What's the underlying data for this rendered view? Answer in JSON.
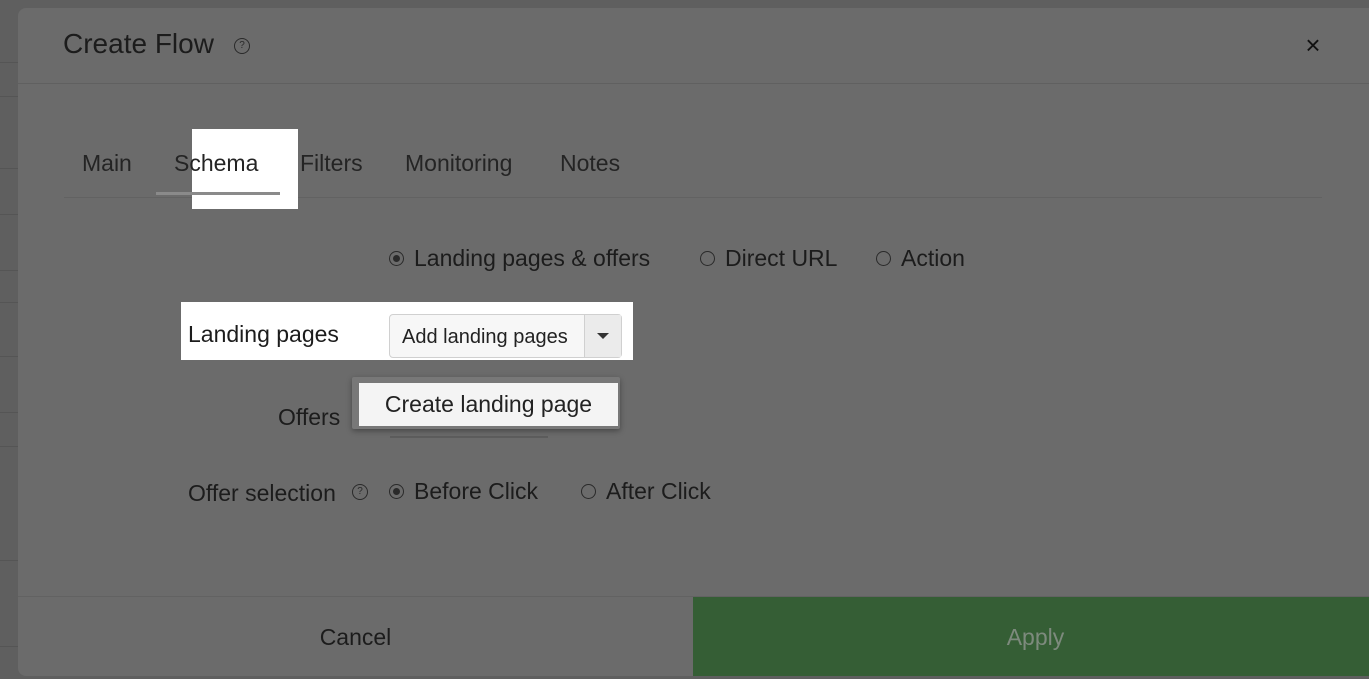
{
  "dialog": {
    "title": "Create Flow",
    "help_symbol": "?",
    "close_symbol": "×"
  },
  "tabs": [
    {
      "label": "Main"
    },
    {
      "label": "Schema",
      "active": true
    },
    {
      "label": "Filters"
    },
    {
      "label": "Monitoring"
    },
    {
      "label": "Notes"
    }
  ],
  "schema_type": {
    "options": [
      {
        "label": "Landing pages & offers",
        "checked": true
      },
      {
        "label": "Direct URL",
        "checked": false
      },
      {
        "label": "Action",
        "checked": false
      }
    ]
  },
  "landing_pages": {
    "label": "Landing pages",
    "select_value": "Add landing pages",
    "dropdown_items": [
      "Create landing page"
    ]
  },
  "offers": {
    "label": "Offers"
  },
  "offer_selection": {
    "label": "Offer selection",
    "help_symbol": "?",
    "options": [
      {
        "label": "Before Click",
        "checked": true
      },
      {
        "label": "After Click",
        "checked": false
      }
    ]
  },
  "footer": {
    "cancel_label": "Cancel",
    "apply_label": "Apply"
  },
  "colors": {
    "overlay": "#5f5f5f",
    "apply_bg": "#355e35",
    "highlight": "#ffffff"
  }
}
